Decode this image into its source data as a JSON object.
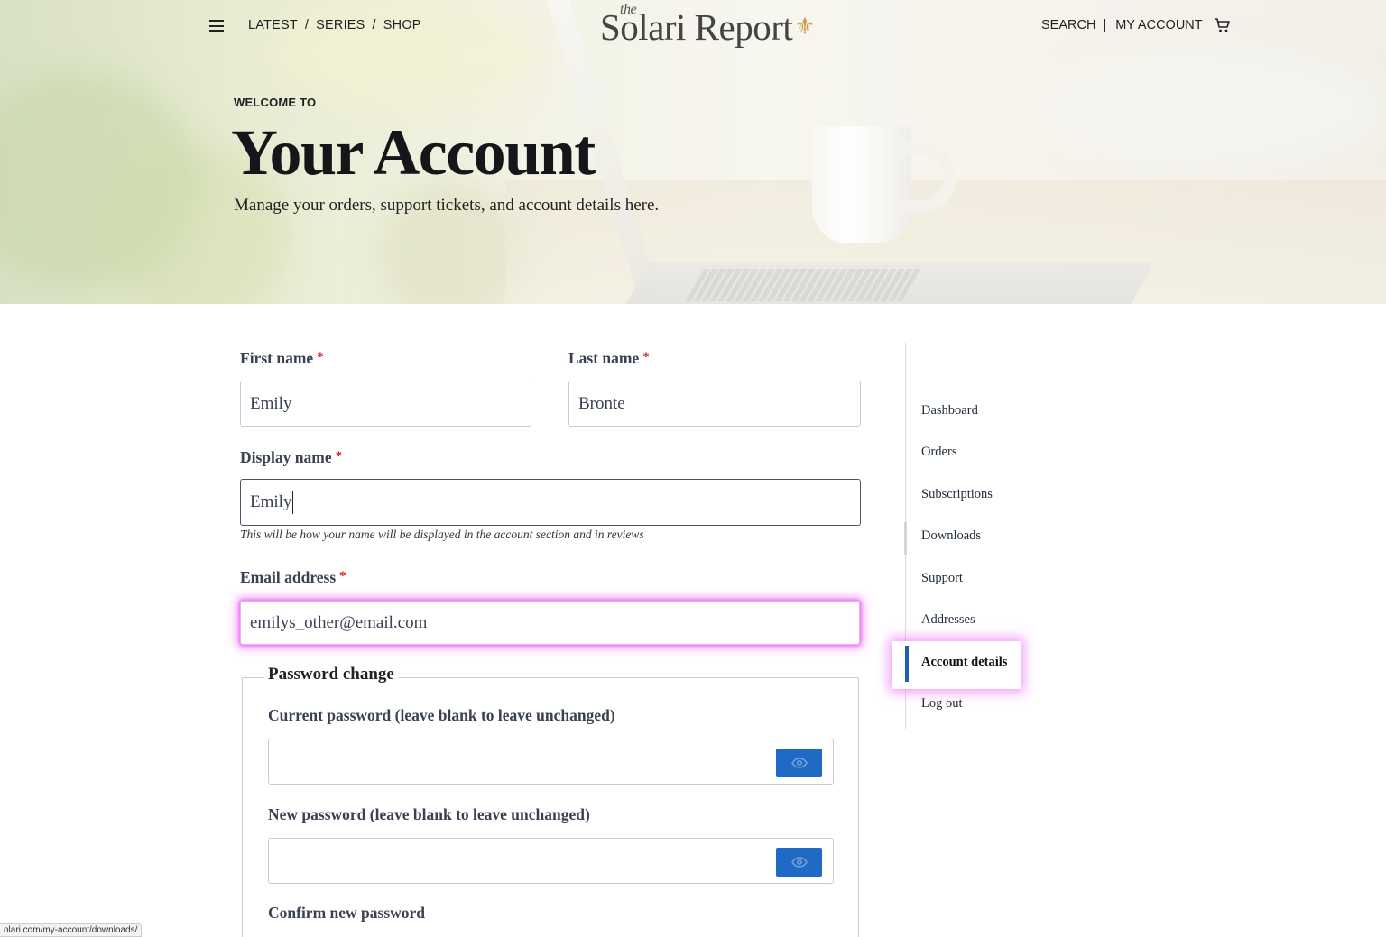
{
  "nav": {
    "latest": "LATEST",
    "separator": "/",
    "series": "SERIES",
    "shop": "SHOP",
    "logo_the": "the",
    "logo_name": "Solari Report",
    "search": "SEARCH",
    "pipe": "|",
    "my_account": "MY ACCOUNT"
  },
  "hero": {
    "eyebrow": "WELCOME TO",
    "title": "Your Account",
    "subtitle": "Manage your orders, support tickets, and account details here."
  },
  "form": {
    "required_mark": "*",
    "first_name_label": "First name",
    "first_name_value": "Emily",
    "last_name_label": "Last name",
    "last_name_value": "Bronte",
    "display_name_label": "Display name",
    "display_name_value": "Emily",
    "display_name_help": "This will be how your name will be displayed in the account section and in reviews",
    "email_label": "Email address",
    "email_value": "emilys_other@email.com",
    "password_legend": "Password change",
    "current_password_label": "Current password (leave blank to leave unchanged)",
    "new_password_label": "New password (leave blank to leave unchanged)",
    "confirm_password_label": "Confirm new password"
  },
  "sidebar": {
    "items": [
      {
        "label": "Dashboard"
      },
      {
        "label": "Orders"
      },
      {
        "label": "Subscriptions"
      },
      {
        "label": "Downloads"
      },
      {
        "label": "Support"
      },
      {
        "label": "Addresses"
      },
      {
        "label": "Account details",
        "active": true
      },
      {
        "label": "Log out"
      }
    ]
  },
  "status_bar": {
    "url": "olari.com/my-account/downloads/"
  },
  "colors": {
    "accent": "#1f6ac4",
    "highlight": "#ec4af6",
    "required": "#d21b1b"
  }
}
